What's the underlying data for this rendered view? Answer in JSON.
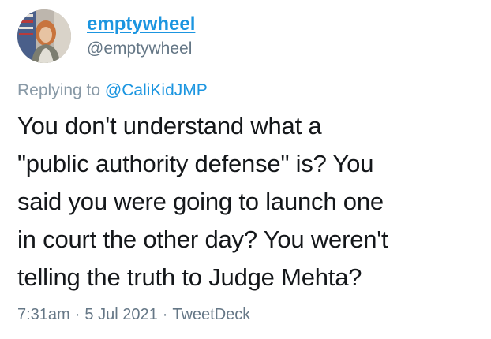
{
  "tweet": {
    "user": {
      "display_name": "emptywheel",
      "handle": "@emptywheel",
      "avatar_icon": "profile-photo"
    },
    "reply": {
      "prefix": "Replying to ",
      "mention": "@CaliKidJMP"
    },
    "text_lines": [
      "You don't understand what a",
      "\"public authority defense\" is? You",
      "said you were going to launch one",
      "in court the other day? You weren't",
      "telling the truth to Judge Mehta?"
    ],
    "meta": {
      "time": "7:31am",
      "separator": "·",
      "date": "5 Jul 2021",
      "source": "TweetDeck"
    },
    "colors": {
      "link": "#1b95e0",
      "text": "#14171a",
      "secondary": "#657786"
    }
  }
}
